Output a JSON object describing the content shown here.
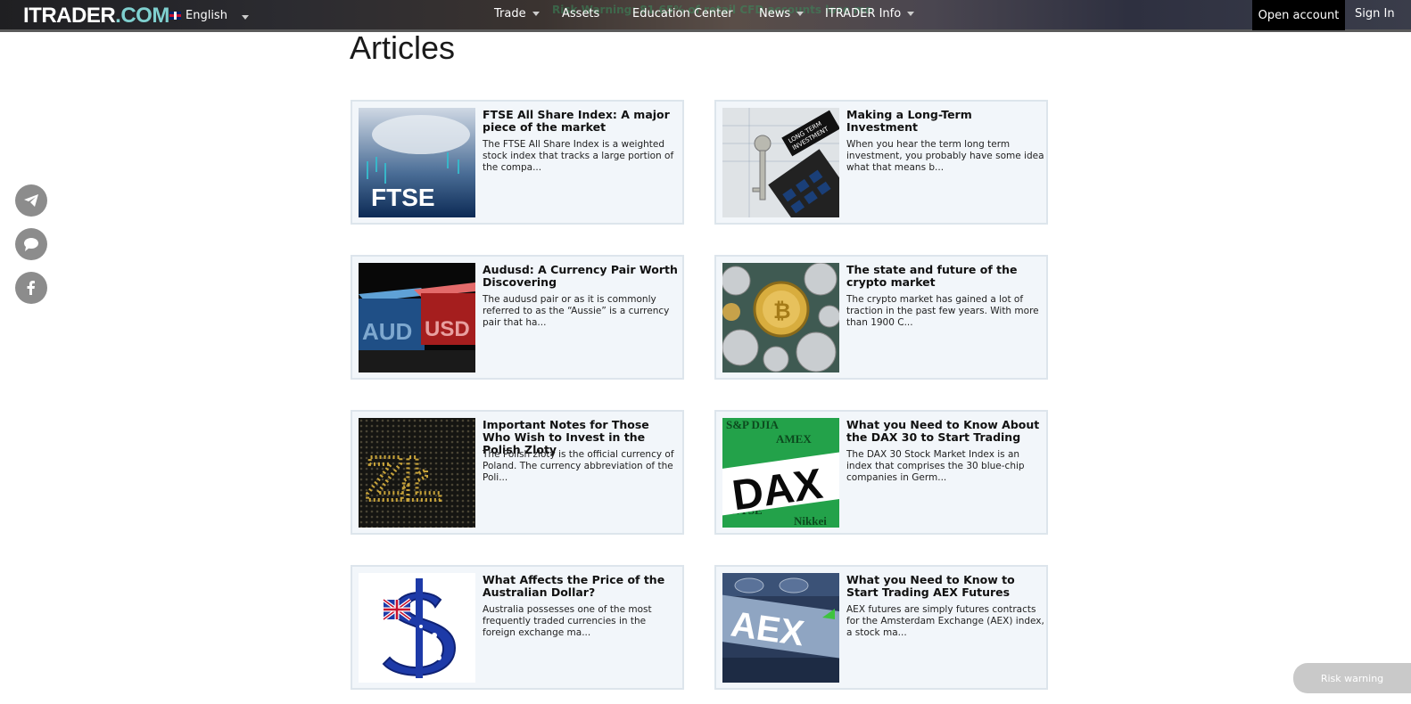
{
  "header": {
    "logo_main": "ITRADER",
    "logo_suffix": ".COM",
    "language": "English",
    "risk_banner": "Risk Warning: 81.65% of retail CFD accounts lose mo",
    "nav": [
      {
        "label": "Trade",
        "has_dropdown": true
      },
      {
        "label": "Assets",
        "has_dropdown": false
      },
      {
        "label": "Education Center",
        "has_dropdown": false
      },
      {
        "label": "News",
        "has_dropdown": true
      },
      {
        "label": "ITRADER Info",
        "has_dropdown": true
      }
    ],
    "open_account": "Open account",
    "sign_in": "Sign In"
  },
  "page_title": "Articles",
  "articles": [
    {
      "title": "FTSE All Share Index: A major piece of the market",
      "excerpt": "The FTSE All Share Index is a weighted stock index that tracks a large portion of the compa...",
      "image": "ftse-image"
    },
    {
      "title": "Making a Long-Term Investment",
      "excerpt": "When you hear the term long term investment, you probably have some idea what that means b...",
      "image": "long-term-investment-image"
    },
    {
      "title": "Audusd: A Currency Pair Worth Discovering",
      "excerpt": "The audusd pair or as it is commonly referred to as the “Aussie” is a currency pair that ha...",
      "image": "aud-usd-image"
    },
    {
      "title": "The state and future of the crypto market",
      "excerpt": "The crypto market has gained a lot of traction in the past few years. With more than 1900 C...",
      "image": "crypto-coins-image"
    },
    {
      "title": "Important Notes for Those Who Wish to Invest in the Polish Zloty",
      "excerpt": "The Polish zloty is the official currency of Poland. The currency abbreviation of the Poli...",
      "image": "zloty-image"
    },
    {
      "title": "What you Need to Know About the DAX 30 to Start Trading",
      "excerpt": "The DAX 30 Stock Market Index is an index that comprises the 30 blue-chip companies in Germ...",
      "image": "dax-image"
    },
    {
      "title": "What Affects the Price of the Australian Dollar?",
      "excerpt": "Australia possesses one of the most frequently traded currencies in the foreign exchange ma...",
      "image": "australian-dollar-image"
    },
    {
      "title": "What you Need to Know to Start Trading AEX Futures",
      "excerpt": "AEX futures are simply futures contracts for the Amsterdam Exchange (AEX) index, a stock ma...",
      "image": "aex-image"
    }
  ],
  "image_text": {
    "ftse": "FTSE",
    "long_term": "LONG TERM",
    "investment": "INVESTMENT",
    "aud": "AUD",
    "usd": "USD",
    "zl": "ZŁ",
    "dax": "DAX",
    "aex": "AEX"
  },
  "social": [
    "telegram-icon",
    "chat-icon",
    "facebook-icon"
  ],
  "risk_warning_button": "Risk warning",
  "colors": {
    "logo_accent": "#7fd0cf",
    "card_bg": "#f2f6fa",
    "card_border": "#dde5ec",
    "open_account_bg": "#000000"
  }
}
